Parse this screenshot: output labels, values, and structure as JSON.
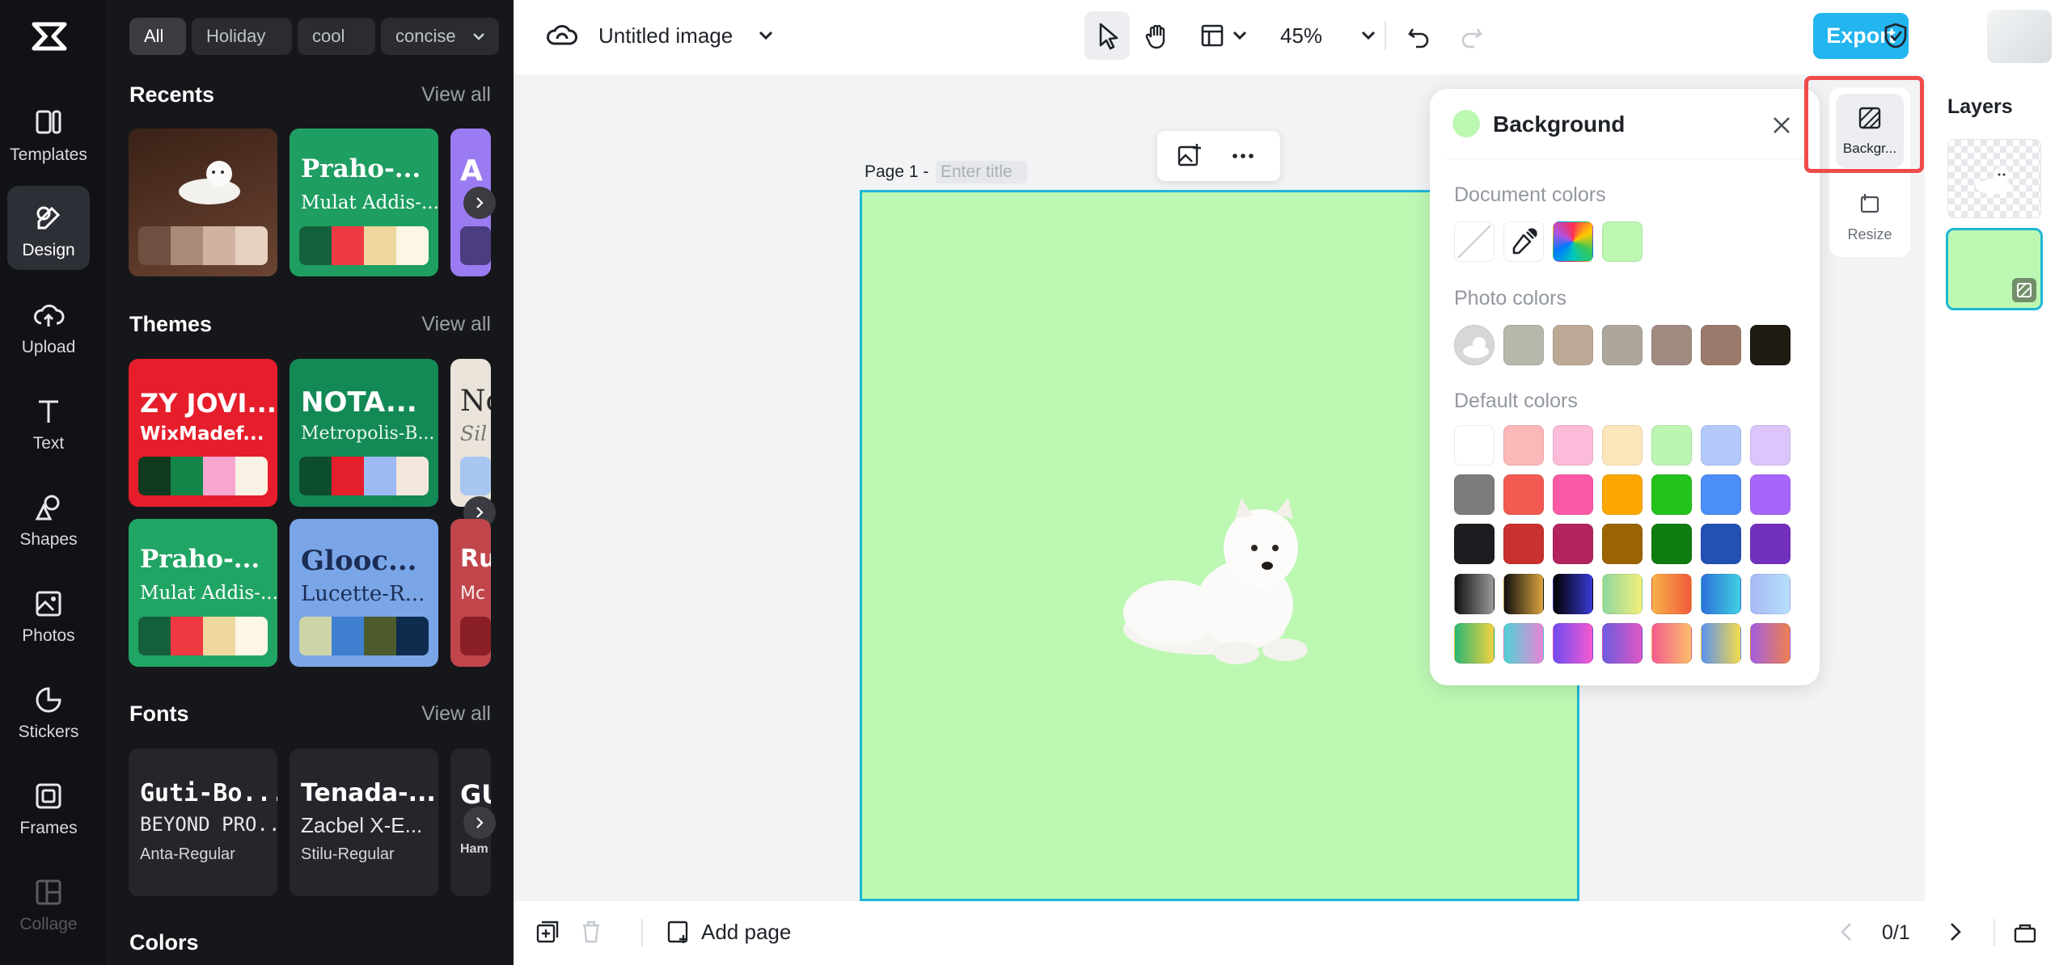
{
  "rail": {
    "items": [
      {
        "label": "Templates",
        "icon": "templates-icon"
      },
      {
        "label": "Design",
        "icon": "design-icon"
      },
      {
        "label": "Upload",
        "icon": "upload-icon"
      },
      {
        "label": "Text",
        "icon": "text-icon"
      },
      {
        "label": "Shapes",
        "icon": "shapes-icon"
      },
      {
        "label": "Photos",
        "icon": "photos-icon"
      },
      {
        "label": "Stickers",
        "icon": "stickers-icon"
      },
      {
        "label": "Frames",
        "icon": "frames-icon"
      },
      {
        "label": "Collage",
        "icon": "collage-icon"
      }
    ]
  },
  "panel": {
    "filters": [
      "All",
      "Holiday",
      "cool",
      "concise"
    ],
    "recents": {
      "title": "Recents",
      "view_all": "View all"
    },
    "recent_cards": [
      {
        "t1": "",
        "t2": ""
      },
      {
        "t1": "Praho-...",
        "t2": "Mulat Addis-..."
      },
      {
        "t1": "A",
        "t2": ""
      }
    ],
    "themes": {
      "title": "Themes",
      "view_all": "View all"
    },
    "theme_cards": [
      {
        "t1": "ZY JOVI...",
        "t2": "WixMadef..."
      },
      {
        "t1": "NOTA...",
        "t2": "Metropolis-B..."
      },
      {
        "t1": "No",
        "t2": "Sil"
      },
      {
        "t1": "Praho-...",
        "t2": "Mulat Addis-..."
      },
      {
        "t1": "Glooc...",
        "t2": "Lucette-R..."
      },
      {
        "t1": "Ru",
        "t2": "Mc"
      }
    ],
    "fonts": {
      "title": "Fonts",
      "view_all": "View all"
    },
    "font_cards": [
      {
        "f1": "Guti-Bo...",
        "f2": "BEYOND PRO...",
        "f3": "Anta-Regular"
      },
      {
        "f1": "Tenada-...",
        "f2": "Zacbel X-E...",
        "f3": "Stilu-Regular"
      },
      {
        "f1": "GU",
        "f2": "",
        "f3": "Ham"
      }
    ],
    "colors": {
      "title": "Colors"
    }
  },
  "topbar": {
    "doc_title": "Untitled image",
    "zoom": "45%",
    "export_label": "Export"
  },
  "canvas": {
    "page_label": "Page 1 -",
    "title_placeholder": "Enter title",
    "page_bg": "#bdf8b3"
  },
  "popover": {
    "title": "Background",
    "current_color": "#bdf8b3",
    "document_colors_label": "Document colors",
    "photo_colors_label": "Photo colors",
    "default_colors_label": "Default colors",
    "photo_colors": [
      "#b5b8ab",
      "#bba996",
      "#aca69c",
      "#a08b81",
      "#9a7b6b",
      "#1f1a12"
    ],
    "default_colors": [
      [
        "#ffffff",
        "#fbb8b8",
        "#fbbbd9",
        "#fde5bb",
        "#bdf5b3",
        "#b2c9f9",
        "#dcc5fb"
      ],
      [
        "#7b7c7d",
        "#f25a52",
        "#fb5aa6",
        "#fba700",
        "#24c21c",
        "#4b8ef7",
        "#a865f9"
      ],
      [
        "#1c1d20",
        "#c8312d",
        "#b3245f",
        "#9a6303",
        "#0d7d10",
        "#2250b3",
        "#7330bc"
      ]
    ]
  },
  "right_tools": {
    "background_label": "Backgr...",
    "resize_label": "Resize"
  },
  "layers": {
    "title": "Layers"
  },
  "bottombar": {
    "add_page_label": "Add page",
    "page_counter": "0/1"
  }
}
